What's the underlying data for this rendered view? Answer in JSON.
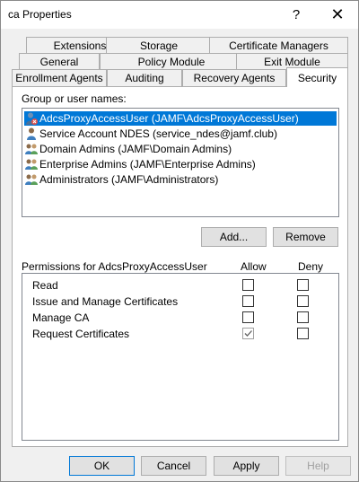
{
  "window": {
    "title": "ca Properties",
    "help_glyph": "?",
    "close_glyph": "✕"
  },
  "tabs": {
    "row1": [
      "Extensions",
      "Storage",
      "Certificate Managers"
    ],
    "row2": [
      "General",
      "Policy Module",
      "Exit Module"
    ],
    "row3": [
      "Enrollment Agents",
      "Auditing",
      "Recovery Agents",
      "Security"
    ],
    "active": "Security"
  },
  "security": {
    "group_label": "Group or user names:",
    "users": [
      {
        "name": "AdcsProxyAccessUser (JAMF\\AdcsProxyAccessUser)",
        "icon": "user-icon",
        "selected": true
      },
      {
        "name": "Service Account NDES (service_ndes@jamf.club)",
        "icon": "user-icon",
        "selected": false
      },
      {
        "name": "Domain Admins (JAMF\\Domain Admins)",
        "icon": "group-icon",
        "selected": false
      },
      {
        "name": "Enterprise Admins (JAMF\\Enterprise Admins)",
        "icon": "group-icon",
        "selected": false
      },
      {
        "name": "Administrators (JAMF\\Administrators)",
        "icon": "group-icon",
        "selected": false
      }
    ],
    "add_label": "Add...",
    "remove_label": "Remove",
    "permissions_label": "Permissions for AdcsProxyAccessUser",
    "allow_label": "Allow",
    "deny_label": "Deny",
    "permissions": [
      {
        "name": "Read",
        "allow": false,
        "deny": false
      },
      {
        "name": "Issue and Manage Certificates",
        "allow": false,
        "deny": false
      },
      {
        "name": "Manage CA",
        "allow": false,
        "deny": false
      },
      {
        "name": "Request Certificates",
        "allow": true,
        "deny": false
      }
    ]
  },
  "footer": {
    "ok_label": "OK",
    "cancel_label": "Cancel",
    "apply_label": "Apply",
    "help_label": "Help"
  },
  "colors": {
    "selection": "#0078d7",
    "dialog_bg": "#f0f0f0"
  }
}
